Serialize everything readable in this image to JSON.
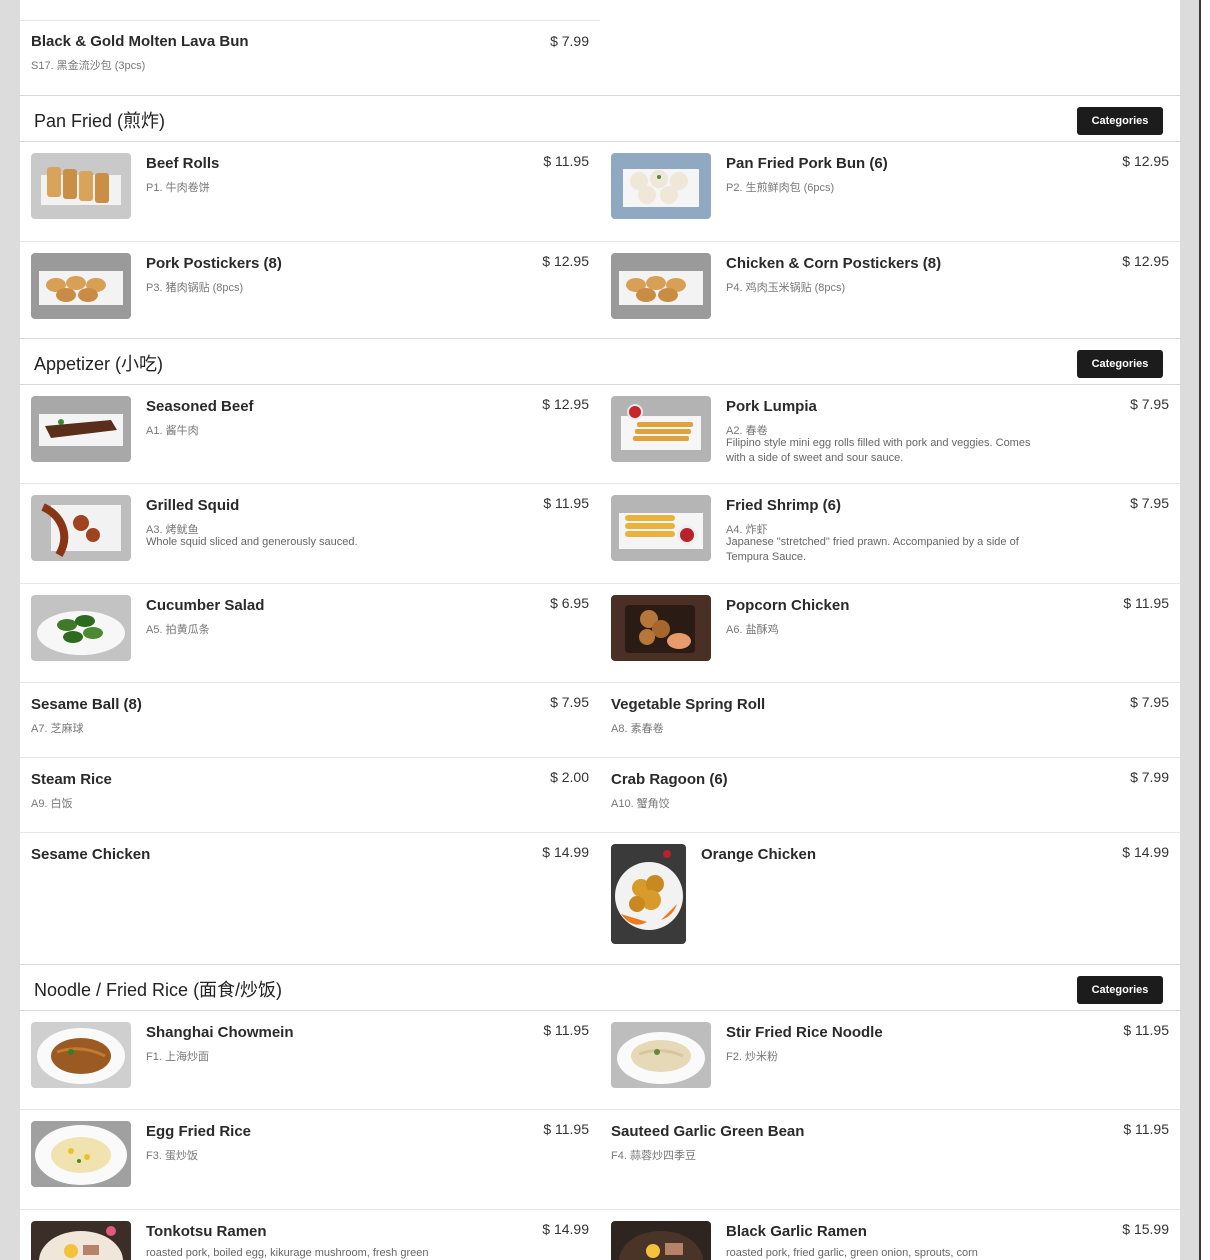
{
  "top_item": {
    "name": "Black & Gold Molten Lava Bun",
    "code": "S17. 黑金流沙包 (3pcs)",
    "price": "$ 7.99"
  },
  "sections": {
    "pan_fried": {
      "title": "Pan Fried (煎炸)",
      "categories_label": "Categories"
    },
    "appetizer": {
      "title": "Appetizer (小吃)",
      "categories_label": "Categories"
    },
    "noodle": {
      "title": "Noodle / Fried Rice (面食/炒饭)",
      "categories_label": "Categories"
    }
  },
  "items": {
    "p1": {
      "name": "Beef Rolls",
      "code": "P1. 牛肉卷饼",
      "price": "$ 11.95"
    },
    "p2": {
      "name": "Pan Fried Pork Bun (6)",
      "code": "P2. 生煎鲜肉包 (6pcs)",
      "price": "$ 12.95"
    },
    "p3": {
      "name": "Pork Postickers (8)",
      "code": "P3. 猪肉锅贴 (8pcs)",
      "price": "$ 12.95"
    },
    "p4": {
      "name": "Chicken & Corn Postickers (8)",
      "code": "P4. 鸡肉玉米锅贴 (8pcs)",
      "price": "$ 12.95"
    },
    "a1": {
      "name": "Seasoned Beef",
      "code": "A1. 酱牛肉",
      "price": "$ 12.95"
    },
    "a2": {
      "name": "Pork Lumpia",
      "code": "A2. 春卷",
      "price": "$ 7.95",
      "desc": "Filipino style mini egg rolls filled with pork and veggies. Comes with a side of sweet and sour sauce."
    },
    "a3": {
      "name": "Grilled Squid",
      "code": "A3. 烤鱿鱼",
      "price": "$ 11.95",
      "desc": "Whole squid sliced and generously sauced."
    },
    "a4": {
      "name": "Fried Shrimp (6)",
      "code": "A4. 炸虾",
      "price": "$ 7.95",
      "desc": "Japanese \"stretched\" fried prawn. Accompanied by a side of Tempura Sauce."
    },
    "a5": {
      "name": "Cucumber Salad",
      "code": "A5. 拍黄瓜条",
      "price": "$ 6.95"
    },
    "a6": {
      "name": "Popcorn Chicken",
      "code": "A6. 盐酥鸡",
      "price": "$ 11.95"
    },
    "a7": {
      "name": "Sesame Ball (8)",
      "code": "A7. 芝麻球",
      "price": "$ 7.95"
    },
    "a8": {
      "name": "Vegetable Spring Roll",
      "code": "A8. 素春卷",
      "price": "$ 7.95"
    },
    "a9": {
      "name": "Steam Rice",
      "code": "A9. 白饭",
      "price": "$ 2.00"
    },
    "a10": {
      "name": "Crab Ragoon (6)",
      "code": "A10. 蟹角饺",
      "price": "$ 7.99"
    },
    "a11": {
      "name": "Sesame Chicken",
      "price": "$ 14.99"
    },
    "a12": {
      "name": "Orange Chicken",
      "price": "$ 14.99"
    },
    "f1": {
      "name": "Shanghai Chowmein",
      "code": "F1. 上海炒面",
      "price": "$ 11.95"
    },
    "f2": {
      "name": "Stir Fried Rice Noodle",
      "code": "F2. 炒米粉",
      "price": "$ 11.95"
    },
    "f3": {
      "name": "Egg Fried Rice",
      "code": "F3. 蛋炒饭",
      "price": "$ 11.95"
    },
    "f4": {
      "name": "Sauteed Garlic Green Bean",
      "code": "F4. 蒜蓉炒四季豆",
      "price": "$ 11.95"
    },
    "f5": {
      "name": "Tonkotsu Ramen",
      "price": "$ 14.99",
      "desc": "roasted pork, boiled egg, kikurage mushroom, fresh green"
    },
    "f6": {
      "name": "Black Garlic Ramen",
      "price": "$ 15.99",
      "desc": "roasted pork, fried garlic, green onion, sprouts, corn"
    }
  }
}
